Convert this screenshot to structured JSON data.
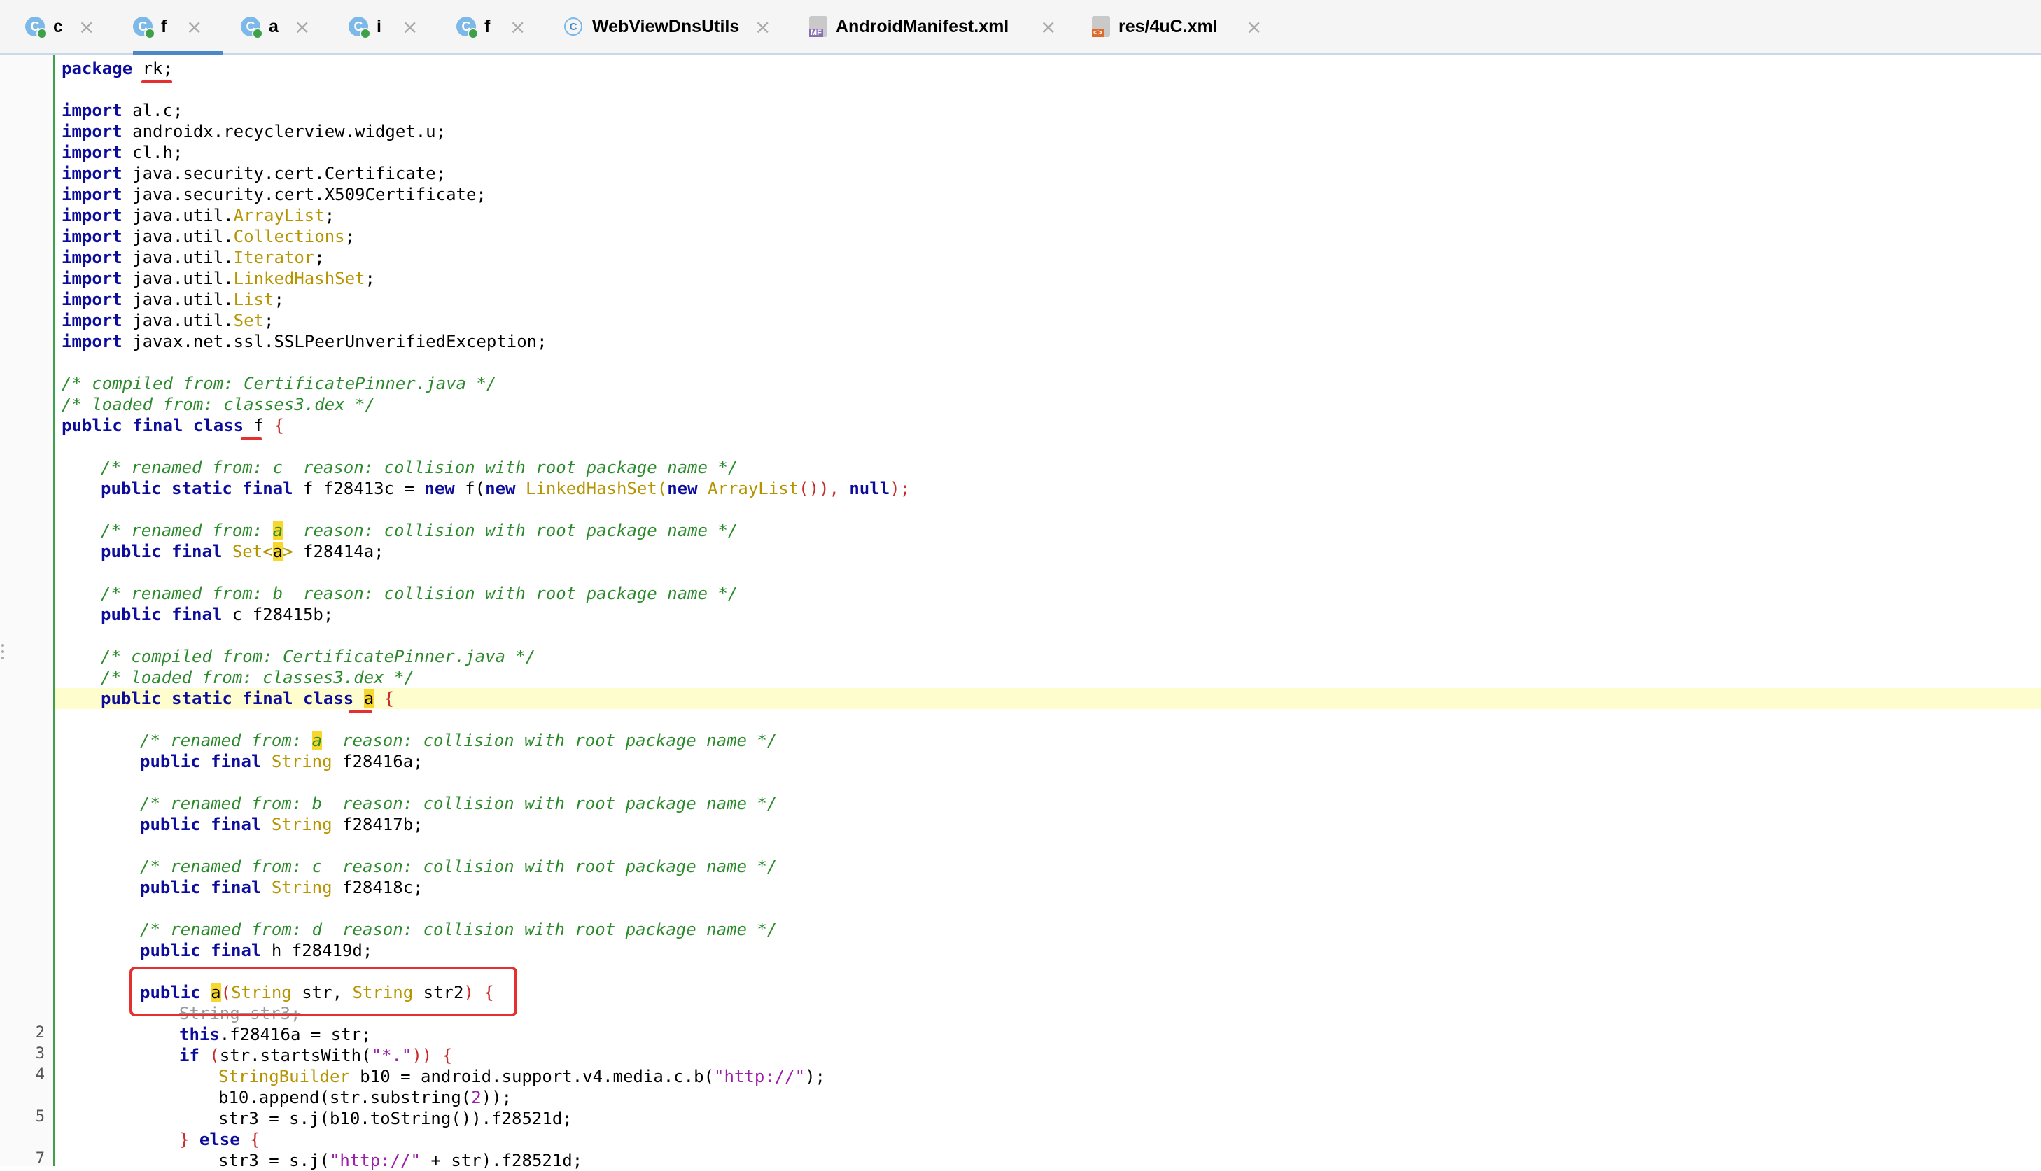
{
  "tabs": [
    {
      "label": "c",
      "icon": "class-icon"
    },
    {
      "label": "f",
      "icon": "class-icon",
      "active": true
    },
    {
      "label": "a",
      "icon": "class-icon"
    },
    {
      "label": "i",
      "icon": "class-icon"
    },
    {
      "label": "f",
      "icon": "class-icon"
    },
    {
      "label": "WebViewDnsUtils",
      "icon": "class-icon"
    },
    {
      "label": "AndroidManifest.xml",
      "icon": "manifest-file-icon",
      "badge": "MF"
    },
    {
      "label": "res/4uC.xml",
      "icon": "xml-file-icon",
      "badge": "<>"
    }
  ],
  "tab_close_glyph": "×",
  "gutter": {
    "line_numbers": [
      "2",
      "3",
      "4",
      "5",
      "7"
    ]
  },
  "code": {
    "package_kw": "package",
    "package_name": "rk;",
    "import_kw": "import",
    "imports": [
      {
        "prefix": "al.c;",
        "type": "",
        "suffix": ""
      },
      {
        "prefix": "androidx.recyclerview.widget.u;",
        "type": "",
        "suffix": ""
      },
      {
        "prefix": "cl.h;",
        "type": "",
        "suffix": ""
      },
      {
        "prefix": "java.security.cert.Certificate;",
        "type": "",
        "suffix": ""
      },
      {
        "prefix": "java.security.cert.X509Certificate;",
        "type": "",
        "suffix": ""
      },
      {
        "prefix": "java.util.",
        "type": "ArrayList",
        "suffix": ";"
      },
      {
        "prefix": "java.util.",
        "type": "Collections",
        "suffix": ";"
      },
      {
        "prefix": "java.util.",
        "type": "Iterator",
        "suffix": ";"
      },
      {
        "prefix": "java.util.",
        "type": "LinkedHashSet",
        "suffix": ";"
      },
      {
        "prefix": "java.util.",
        "type": "List",
        "suffix": ";"
      },
      {
        "prefix": "java.util.",
        "type": "Set",
        "suffix": ";"
      },
      {
        "prefix": "javax.net.ssl.SSLPeerUnverifiedException;",
        "type": "",
        "suffix": ""
      }
    ],
    "compiled_from_outer": "/* compiled from: CertificatePinner.java */",
    "loaded_from_outer": "/* loaded from: classes3.dex */",
    "outer_class_kw": "public final class",
    "outer_class_name": "f",
    "brace_open": "{",
    "comment_renamed_c": "/* renamed from: c  reason: collision with root package name */",
    "field_c": {
      "kw": "public static final",
      "t1": "f",
      "name": "f28413c =",
      "kw_new": "new",
      "ctor": "f(",
      "kw_new2": "new",
      "t2": "LinkedHashSet(",
      "kw_new3": "new",
      "t3": "ArrayList",
      "close": "()),",
      "kw_null": "null",
      "end": ");"
    },
    "comment_renamed_a_prefix": "/* renamed from: ",
    "comment_renamed_a_hl": "a",
    "comment_renamed_a_suffix": "  reason: collision with root package name */",
    "field_a": {
      "kw": "public final",
      "type": "Set<",
      "hl": "a",
      "type_close": ">",
      "rest": " f28414a;"
    },
    "comment_renamed_b": "/* renamed from: b  reason: collision with root package name */",
    "field_b": {
      "kw": "public final",
      "rest": " c f28415b;"
    },
    "compiled_from_inner": "/* compiled from: CertificatePinner.java */",
    "loaded_from_inner": "/* loaded from: classes3.dex */",
    "inner_class_kw": "public static final class",
    "inner_class_name": "a",
    "inner_comment_a_prefix": "/* renamed from: ",
    "inner_comment_a_hl": "a",
    "inner_comment_a_suffix": "  reason: collision with root package name */",
    "inner_field_a": {
      "kw": "public final",
      "type": "String",
      "rest": " f28416a;"
    },
    "inner_comment_b": "/* renamed from: b  reason: collision with root package name */",
    "inner_field_b": {
      "kw": "public final",
      "type": "String",
      "rest": " f28417b;"
    },
    "inner_comment_c": "/* renamed from: c  reason: collision with root package name */",
    "inner_field_c": {
      "kw": "public final",
      "type": "String",
      "rest": " f28418c;"
    },
    "inner_comment_d": "/* renamed from: d  reason: collision with root package name */",
    "inner_field_d": {
      "kw": "public final",
      "rest": " h f28419d;"
    },
    "ctor": {
      "kw": "public",
      "name": "a",
      "open": "(",
      "t1": "String",
      "p1": " str, ",
      "t2": "String",
      "p2": " str2",
      "close": ")",
      "brace": "{"
    },
    "ctor_line2": {
      "type": "String",
      "rest": " str3;"
    },
    "ctor_line3": {
      "kw": "this",
      ".rest": ".f28416a = str;"
    },
    "ctor_line4": {
      "kw": "if",
      "paren": "(",
      "call": "str.startsWith(",
      "str": "\"*.\"",
      "close": "))",
      "brace": "{"
    },
    "ctor_line5": {
      "type": "StringBuilder",
      "mid": " b10 = android.support.v4.media.c.b(",
      "str": "\"http://\"",
      "end": ");"
    },
    "ctor_line6": {
      "pre": "b10.append(str.substring(",
      "num": "2",
      "end": "));"
    },
    "ctor_line7": {
      "pre": "str3 = s.j(b10.toString()).f28521d;"
    },
    "ctor_line8": {
      "brace": "}",
      "kw": "else",
      "brace2": "{"
    },
    "ctor_line9": {
      "pre": "str3 = s.j(",
      "str": "\"http://\"",
      "end": " + str).f28521d;"
    }
  },
  "colors": {
    "keyword": "#0c0c9c",
    "type": "#b59400",
    "comment": "#2b8a2b",
    "string": "#9c1fa9",
    "highlight": "#f7d72c",
    "current_line": "#fefdcd",
    "annotation_red": "#e53030",
    "gutter_change": "#3ea04a"
  }
}
